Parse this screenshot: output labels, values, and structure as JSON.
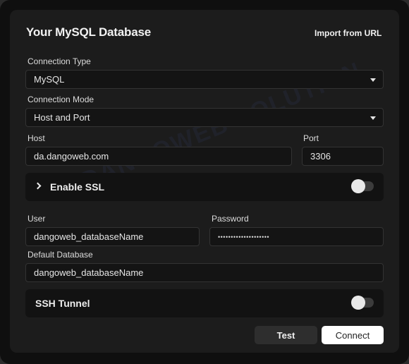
{
  "dialog": {
    "title": "Your MySQL Database",
    "import_link": "Import from URL"
  },
  "connection_type": {
    "label": "Connection Type",
    "value": "MySQL"
  },
  "connection_mode": {
    "label": "Connection Mode",
    "value": "Host and Port"
  },
  "host": {
    "label": "Host",
    "value": "da.dangoweb.com"
  },
  "port": {
    "label": "Port",
    "value": "3306"
  },
  "ssl": {
    "label": "Enable SSL",
    "enabled": false
  },
  "user": {
    "label": "User",
    "value": "dangoweb_databaseName"
  },
  "password": {
    "label": "Password",
    "value": "••••••••••••••••••••"
  },
  "default_database": {
    "label": "Default Database",
    "value": "dangoweb_databaseName"
  },
  "ssh": {
    "label": "SSH Tunnel",
    "enabled": false
  },
  "buttons": {
    "test": "Test",
    "connect": "Connect"
  },
  "watermark": "DANGOWEB SOLUTION",
  "icons": {
    "caret": "caret-down-icon",
    "chevron": "chevron-right-icon"
  },
  "colors": {
    "background": "#1c1c1c",
    "field": "#141414",
    "primary_button": "#ffffff"
  }
}
